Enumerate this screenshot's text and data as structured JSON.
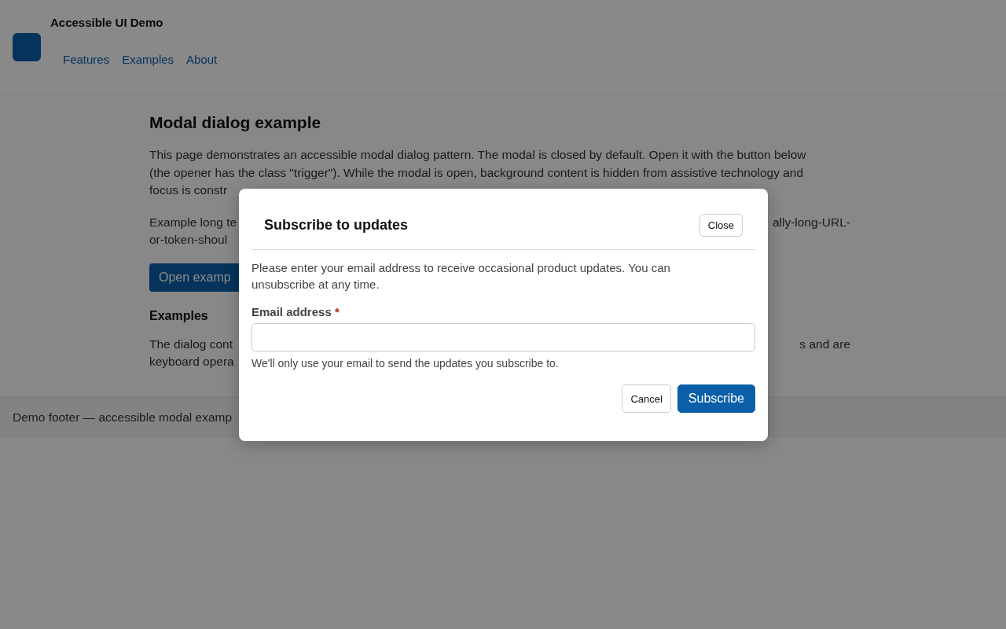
{
  "page": {
    "site_title": "Accessible UI Demo",
    "nav": [
      {
        "label": "Features"
      },
      {
        "label": "Examples"
      },
      {
        "label": "About"
      }
    ],
    "heading": "Modal dialog example",
    "intro_lines": [
      "This page demonstrates an accessible modal dialog pattern. The modal is closed by default. Open it with the button below",
      "(the opener has the class \"trigger\"). While the modal is open, background content is hidden from assistive technology and",
      "focus is constr"
    ],
    "long_text": [
      {
        "left": "Example long te",
        "right": "ally-long-URL-"
      },
      {
        "left": "or-token-shoul"
      }
    ],
    "open_button": "Open examp",
    "examples_heading": "Examples",
    "examples_text": [
      {
        "left": "The dialog cont",
        "right": "s and are"
      },
      {
        "left": "keyboard opera"
      }
    ],
    "footer": "Demo footer — accessible modal examp"
  },
  "dialog": {
    "title": "Subscribe to updates",
    "close_button": "Close",
    "description": "Please enter your email address to receive occasional product updates. You can unsubscribe at any time.",
    "field": {
      "label": "Email address",
      "required_mark": "*",
      "hint": "We'll only use your email to send the updates you subscribe to."
    },
    "buttons": [
      {
        "label": "Cancel",
        "kind": "secondary"
      },
      {
        "label": "Subscribe",
        "kind": "primary"
      }
    ]
  }
}
